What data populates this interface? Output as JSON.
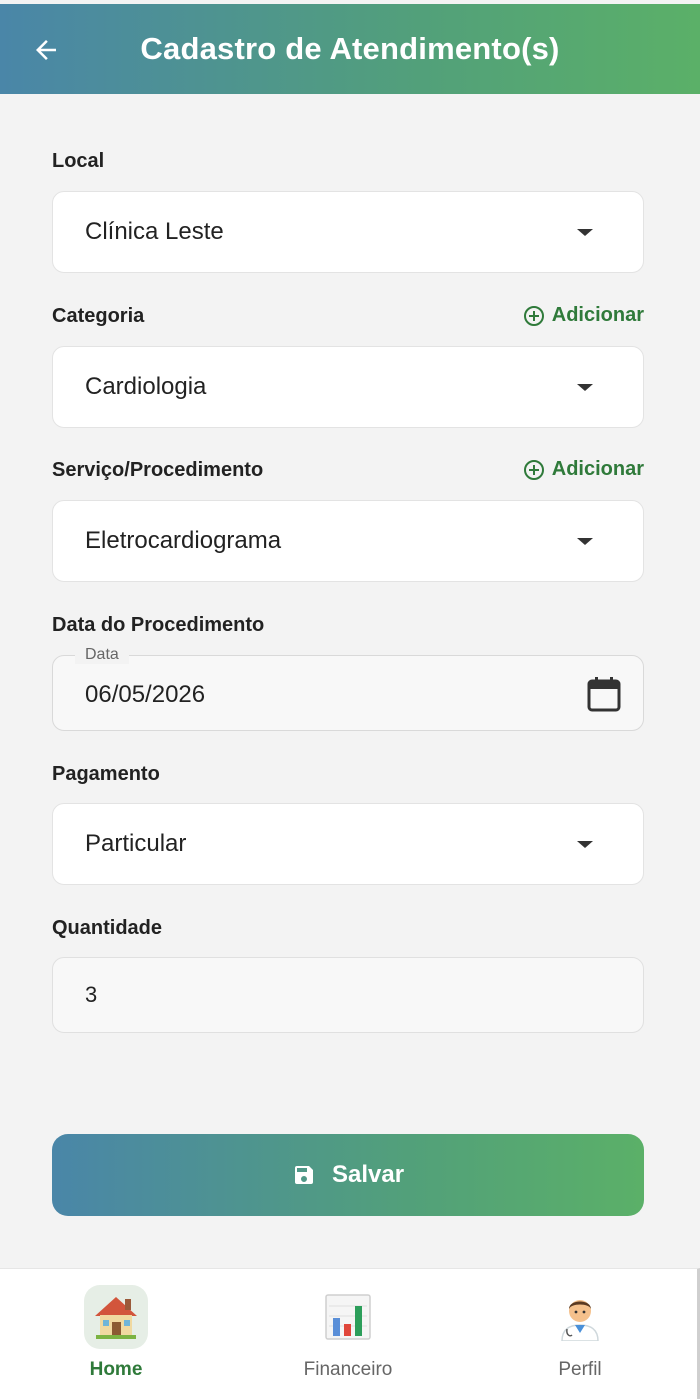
{
  "header": {
    "title": "Cadastro de Atendimento(s)"
  },
  "form": {
    "local": {
      "label": "Local",
      "value": "Clínica Leste"
    },
    "categoria": {
      "label": "Categoria",
      "value": "Cardiologia",
      "add_label": "Adicionar"
    },
    "servico": {
      "label": "Serviço/Procedimento",
      "value": "Eletrocardiograma",
      "add_label": "Adicionar"
    },
    "data": {
      "label": "Data do Procedimento",
      "field_label": "Data",
      "value": "06/05/2026"
    },
    "pagamento": {
      "label": "Pagamento",
      "value": "Particular"
    },
    "quantidade": {
      "label": "Quantidade",
      "value": "3"
    },
    "save_label": "Salvar"
  },
  "bottom_nav": {
    "active": "Home",
    "items": [
      {
        "label": "Home",
        "icon": "house-icon"
      },
      {
        "label": "Financeiro",
        "icon": "bar-chart-icon"
      },
      {
        "label": "Perfil",
        "icon": "doctor-icon"
      }
    ]
  },
  "colors": {
    "gradient_start": "#4a86a8",
    "gradient_end": "#5bb068",
    "accent_green": "#2f7a3a",
    "background": "#f3f3f3"
  }
}
